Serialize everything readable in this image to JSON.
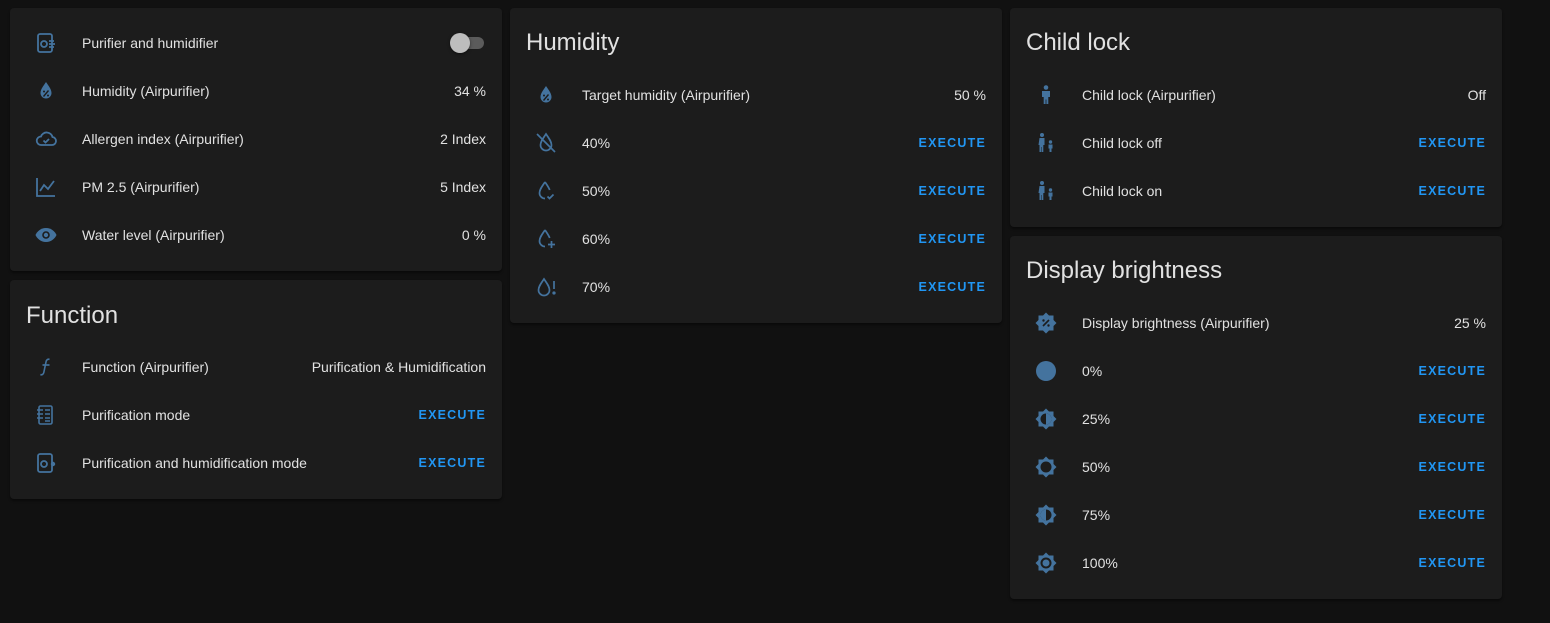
{
  "colors": {
    "background": "#111111",
    "card": "#1c1c1c",
    "icon": "#44739e",
    "accent": "#2196f3",
    "text": "#e1e1e1"
  },
  "status_card": {
    "rows": [
      {
        "label": "Purifier and humidifier",
        "icon": "air-purifier-icon",
        "toggle_on": false
      },
      {
        "label": "Humidity (Airpurifier)",
        "value": "34 %",
        "icon": "water-percent-icon"
      },
      {
        "label": "Allergen index (Airpurifier)",
        "value": "2 Index",
        "icon": "cloud-check-icon"
      },
      {
        "label": "PM 2.5 (Airpurifier)",
        "value": "5 Index",
        "icon": "chart-line-icon"
      },
      {
        "label": "Water level (Airpurifier)",
        "value": "0 %",
        "icon": "eye-icon"
      }
    ]
  },
  "function_card": {
    "title": "Function",
    "rows": [
      {
        "label": "Function (Airpurifier)",
        "value": "Purification & Humidification",
        "icon": "function-icon"
      },
      {
        "label": "Purification mode",
        "action": "EXECUTE",
        "icon": "air-filter-icon"
      },
      {
        "label": "Purification and humidification mode",
        "action": "EXECUTE",
        "icon": "air-purifier-icon"
      }
    ]
  },
  "humidity_card": {
    "title": "Humidity",
    "rows": [
      {
        "label": "Target humidity (Airpurifier)",
        "value": "50 %",
        "icon": "water-percent-icon"
      },
      {
        "label": "40%",
        "action": "EXECUTE",
        "icon": "water-off-icon"
      },
      {
        "label": "50%",
        "action": "EXECUTE",
        "icon": "water-check-icon"
      },
      {
        "label": "60%",
        "action": "EXECUTE",
        "icon": "water-plus-icon"
      },
      {
        "label": "70%",
        "action": "EXECUTE",
        "icon": "water-alert-icon"
      }
    ]
  },
  "child_lock_card": {
    "title": "Child lock",
    "rows": [
      {
        "label": "Child lock (Airpurifier)",
        "value": "Off",
        "icon": "human-child-icon"
      },
      {
        "label": "Child lock off",
        "action": "EXECUTE",
        "icon": "human-male-child-icon"
      },
      {
        "label": "Child lock on",
        "action": "EXECUTE",
        "icon": "human-male-child-icon"
      }
    ]
  },
  "brightness_card": {
    "title": "Display brightness",
    "rows": [
      {
        "label": "Display brightness (Airpurifier)",
        "value": "25 %",
        "icon": "brightness-percent-icon"
      },
      {
        "label": "0%",
        "action": "EXECUTE",
        "icon": "brightness-1-icon"
      },
      {
        "label": "25%",
        "action": "EXECUTE",
        "icon": "brightness-4-icon"
      },
      {
        "label": "50%",
        "action": "EXECUTE",
        "icon": "brightness-5-icon"
      },
      {
        "label": "75%",
        "action": "EXECUTE",
        "icon": "brightness-6-icon"
      },
      {
        "label": "100%",
        "action": "EXECUTE",
        "icon": "brightness-7-icon"
      }
    ]
  }
}
